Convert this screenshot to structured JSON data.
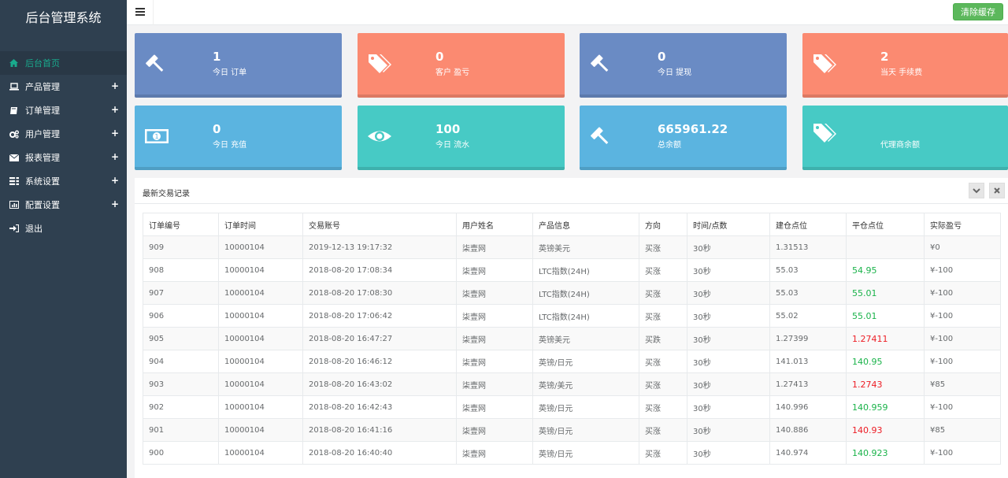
{
  "app": {
    "title": "后台管理系统"
  },
  "sidebar": {
    "items": [
      {
        "label": "后台首页",
        "icon": "home-icon",
        "active": true,
        "expandable": false
      },
      {
        "label": "产品管理",
        "icon": "laptop-icon",
        "active": false,
        "expandable": true
      },
      {
        "label": "订单管理",
        "icon": "book-icon",
        "active": false,
        "expandable": true
      },
      {
        "label": "用户管理",
        "icon": "gears-icon",
        "active": false,
        "expandable": true
      },
      {
        "label": "报表管理",
        "icon": "envelope-icon",
        "active": false,
        "expandable": true
      },
      {
        "label": "系统设置",
        "icon": "tasks-icon",
        "active": false,
        "expandable": true
      },
      {
        "label": "配置设置",
        "icon": "chart-icon",
        "active": false,
        "expandable": true
      },
      {
        "label": "退出",
        "icon": "sign-out-icon",
        "active": false,
        "expandable": false
      }
    ],
    "plus": "+"
  },
  "topbar": {
    "clear_cache": "清除缓存"
  },
  "cards": [
    {
      "value": "1",
      "label": "今日 订单",
      "icon": "gavel-icon",
      "color": "#6a8bc4"
    },
    {
      "value": "0",
      "label": "客户 盈亏",
      "icon": "tags-icon",
      "color": "#fb8a71"
    },
    {
      "value": "0",
      "label": "今日 提现",
      "icon": "gavel-icon",
      "color": "#6a8bc4"
    },
    {
      "value": "2",
      "label": "当天 手续费",
      "icon": "tags-icon",
      "color": "#fb8a71"
    },
    {
      "value": "0",
      "label": "今日 充值",
      "icon": "money-icon",
      "color": "#5bb4e0"
    },
    {
      "value": "100",
      "label": "今日 流水",
      "icon": "eye-icon",
      "color": "#47cac5"
    },
    {
      "value": "665961.22",
      "label": "总余额",
      "icon": "gavel-icon",
      "color": "#5bb4e0"
    },
    {
      "value": "",
      "label": "代理商余额",
      "icon": "tags-icon",
      "color": "#47cac5"
    }
  ],
  "trades": {
    "title": "最新交易记录",
    "collapse_icon": "chevron-down-icon",
    "close_icon": "close-icon",
    "columns": [
      "订单编号",
      "订单时间",
      "交易账号",
      "用户姓名",
      "产品信息",
      "方向",
      "时间/点数",
      "建仓点位",
      "平仓点位",
      "实际盈亏"
    ],
    "rows": [
      [
        "909",
        "10000104",
        "2019-12-13 19:17:32",
        "柒壹网",
        "英镑美元",
        "买涨",
        "30秒",
        "1.31513",
        "",
        "¥0"
      ],
      [
        "908",
        "10000104",
        "2018-08-20 17:08:34",
        "柒壹网",
        "LTC指数(24H)",
        "买涨",
        "30秒",
        "55.03",
        "54.95",
        "¥-100"
      ],
      [
        "907",
        "10000104",
        "2018-08-20 17:08:30",
        "柒壹网",
        "LTC指数(24H)",
        "买涨",
        "30秒",
        "55.03",
        "55.01",
        "¥-100"
      ],
      [
        "906",
        "10000104",
        "2018-08-20 17:06:42",
        "柒壹网",
        "LTC指数(24H)",
        "买涨",
        "30秒",
        "55.02",
        "55.01",
        "¥-100"
      ],
      [
        "905",
        "10000104",
        "2018-08-20 16:47:27",
        "柒壹网",
        "英镑美元",
        "买跌",
        "30秒",
        "1.27399",
        "1.27411",
        "¥-100"
      ],
      [
        "904",
        "10000104",
        "2018-08-20 16:46:12",
        "柒壹网",
        "英镑/日元",
        "买涨",
        "30秒",
        "141.013",
        "140.95",
        "¥-100"
      ],
      [
        "903",
        "10000104",
        "2018-08-20 16:43:02",
        "柒壹网",
        "英镑/美元",
        "买涨",
        "30秒",
        "1.27413",
        "1.2743",
        "¥85"
      ],
      [
        "902",
        "10000104",
        "2018-08-20 16:42:43",
        "柒壹网",
        "英镑/日元",
        "买涨",
        "30秒",
        "140.996",
        "140.959",
        "¥-100"
      ],
      [
        "901",
        "10000104",
        "2018-08-20 16:41:16",
        "柒壹网",
        "英镑/日元",
        "买涨",
        "30秒",
        "140.886",
        "140.93",
        "¥85"
      ],
      [
        "900",
        "10000104",
        "2018-08-20 16:40:40",
        "柒壹网",
        "英镑/日元",
        "买涨",
        "30秒",
        "140.974",
        "140.923",
        "¥-100"
      ]
    ],
    "close_price_colors": [
      "",
      "green",
      "green",
      "green",
      "red",
      "green",
      "red",
      "green",
      "red",
      "green"
    ],
    "status_colors": {
      "green": "#1ab34a",
      "red": "#ed1c24"
    }
  }
}
